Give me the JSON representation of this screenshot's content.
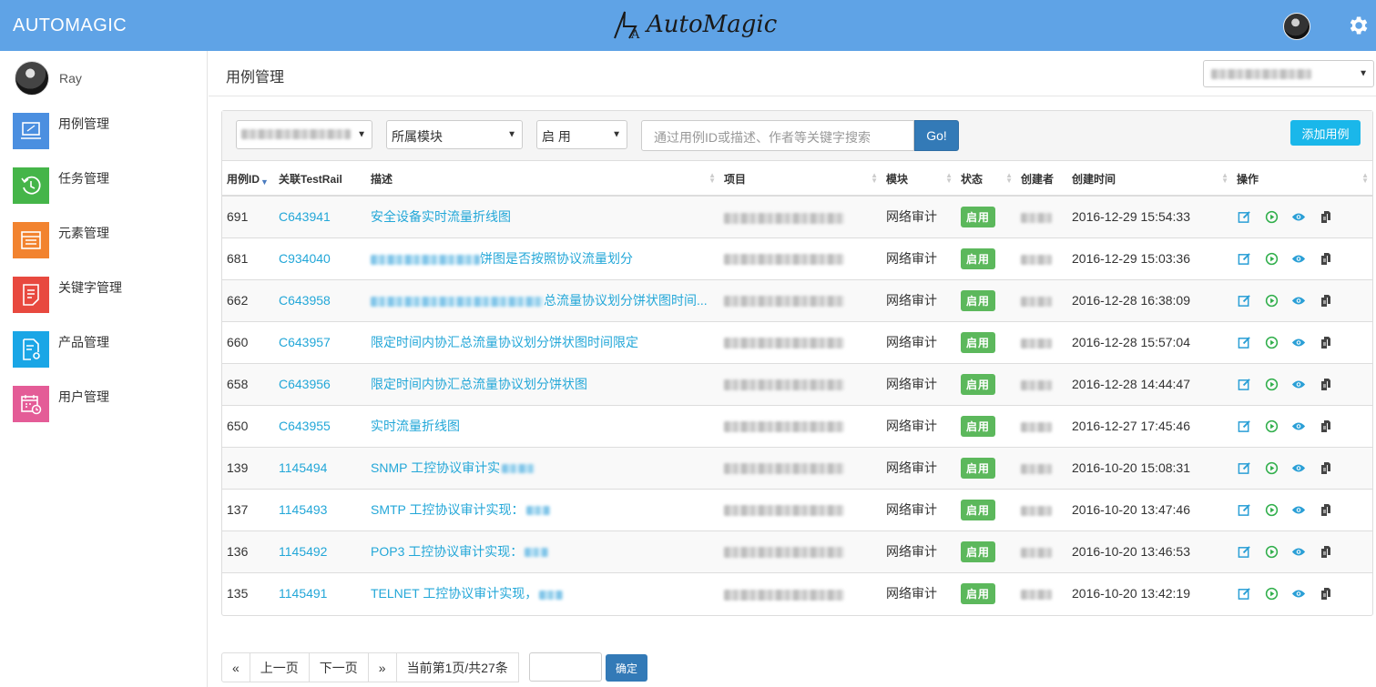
{
  "header": {
    "brand": "AUTOMAGIC",
    "logo_text": "AutoMagic"
  },
  "sidebar": {
    "user_name": "Ray",
    "items": [
      {
        "label": "用例管理",
        "color": "#4b8fe0",
        "icon": "laptop-icon"
      },
      {
        "label": "任务管理",
        "color": "#45b549",
        "icon": "history-icon"
      },
      {
        "label": "元素管理",
        "color": "#f2832f",
        "icon": "list-icon"
      },
      {
        "label": "关键字管理",
        "color": "#e8493f",
        "icon": "document-icon"
      },
      {
        "label": "产品管理",
        "color": "#1aa6e6",
        "icon": "file-gear-icon"
      },
      {
        "label": "用户管理",
        "color": "#e45c97",
        "icon": "calendar-clock-icon"
      }
    ]
  },
  "main": {
    "page_title": "用例管理",
    "filters": {
      "module": "所属模块",
      "status": "启 用",
      "search_placeholder": "通过用例ID或描述、作者等关键字搜索",
      "go": "Go!",
      "add": "添加用例"
    },
    "columns": [
      "用例ID",
      "关联TestRail",
      "描述",
      "项目",
      "模块",
      "状态",
      "创建者",
      "创建时间",
      "操作"
    ],
    "rows": [
      {
        "id": "691",
        "testrail": "C643941",
        "desc": "安全设备实时流量折线图",
        "desc_prefix_blur": false,
        "module": "网络审计",
        "status": "启用",
        "time": "2016-12-29 15:54:33"
      },
      {
        "id": "681",
        "testrail": "C934040",
        "desc": "饼图是否按照协议流量划分",
        "desc_prefix_blur": true,
        "module": "网络审计",
        "status": "启用",
        "time": "2016-12-29 15:03:36"
      },
      {
        "id": "662",
        "testrail": "C643958",
        "desc": "总流量协议划分饼状图时间...",
        "desc_prefix_blur": true,
        "module": "网络审计",
        "status": "启用",
        "time": "2016-12-28 16:38:09"
      },
      {
        "id": "660",
        "testrail": "C643957",
        "desc": "限定时间内协汇总流量协议划分饼状图时间限定",
        "desc_prefix_blur": false,
        "module": "网络审计",
        "status": "启用",
        "time": "2016-12-28 15:57:04"
      },
      {
        "id": "658",
        "testrail": "C643956",
        "desc": "限定时间内协汇总流量协议划分饼状图",
        "desc_prefix_blur": false,
        "module": "网络审计",
        "status": "启用",
        "time": "2016-12-28 14:44:47"
      },
      {
        "id": "650",
        "testrail": "C643955",
        "desc": "实时流量折线图",
        "desc_prefix_blur": false,
        "module": "网络审计",
        "status": "启用",
        "time": "2016-12-27 17:45:46"
      },
      {
        "id": "139",
        "testrail": "1145494",
        "desc": "SNMP 工控协议审计实",
        "desc_prefix_blur": false,
        "module": "网络审计",
        "status": "启用",
        "time": "2016-10-20 15:08:31"
      },
      {
        "id": "137",
        "testrail": "1145493",
        "desc": "SMTP 工控协议审计实现：",
        "desc_prefix_blur": false,
        "module": "网络审计",
        "status": "启用",
        "time": "2016-10-20 13:47:46"
      },
      {
        "id": "136",
        "testrail": "1145492",
        "desc": "POP3 工控协议审计实现：",
        "desc_prefix_blur": false,
        "module": "网络审计",
        "status": "启用",
        "time": "2016-10-20 13:46:53"
      },
      {
        "id": "135",
        "testrail": "1145491",
        "desc": "TELNET 工控协议审计实现，",
        "desc_prefix_blur": false,
        "module": "网络审计",
        "status": "启用",
        "time": "2016-10-20 13:42:19"
      }
    ]
  },
  "pager": {
    "first": "«",
    "prev": "上一页",
    "next": "下一页",
    "last": "»",
    "info": "当前第1页/共27条",
    "confirm": "确定"
  }
}
